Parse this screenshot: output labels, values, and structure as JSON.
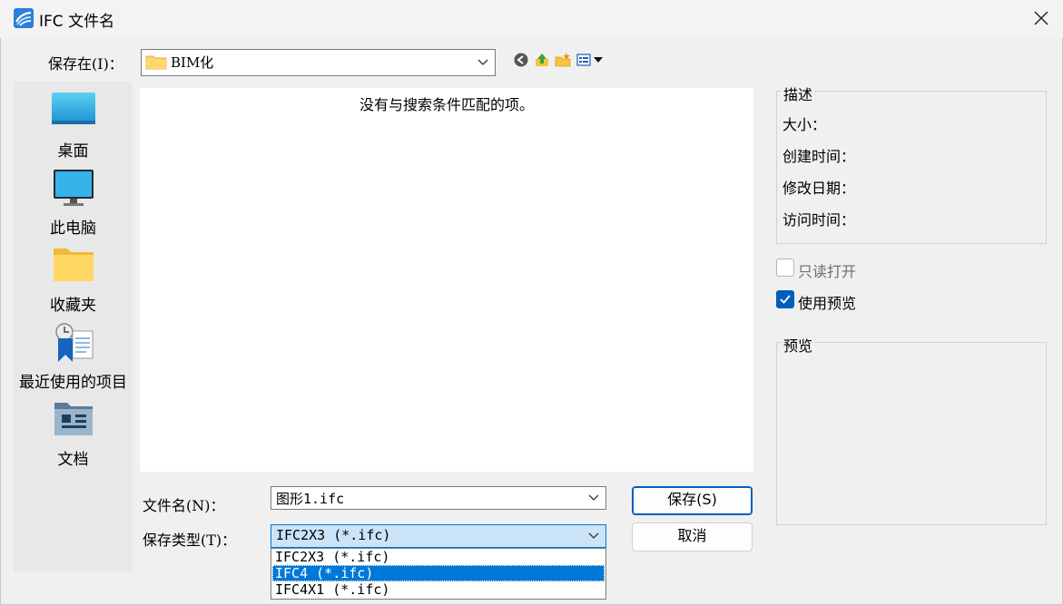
{
  "window": {
    "title": "IFC 文件名"
  },
  "save_in": {
    "label": "保存在(I)：",
    "value": "BIM化"
  },
  "places": [
    {
      "label": "桌面",
      "icon": "desktop-icon"
    },
    {
      "label": "此电脑",
      "icon": "computer-icon"
    },
    {
      "label": "收藏夹",
      "icon": "folder-icon"
    },
    {
      "label": "最近使用的项目",
      "icon": "recent-icon"
    },
    {
      "label": "文档",
      "icon": "documents-icon"
    }
  ],
  "file_list": {
    "empty_text": "没有与搜索条件匹配的项。"
  },
  "description": {
    "title": "描述",
    "rows": [
      "大小：",
      "创建时间：",
      "修改日期：",
      "访问时间："
    ]
  },
  "options": {
    "read_only": {
      "label": "只读打开",
      "checked": false
    },
    "use_preview": {
      "label": "使用预览",
      "checked": true
    }
  },
  "preview": {
    "title": "预览"
  },
  "filename": {
    "label": "文件名(N)：",
    "value": "图形1.ifc"
  },
  "filetype": {
    "label": "保存类型(T)：",
    "value": "IFC2X3 (*.ifc)",
    "options": [
      "IFC2X3 (*.ifc)",
      "IFC4 (*.ifc)",
      "IFC4X1 (*.ifc)"
    ],
    "highlighted": "IFC4 (*.ifc)"
  },
  "buttons": {
    "save": "保存(S)",
    "cancel": "取消"
  },
  "colors": {
    "accent": "#005fb8",
    "selection": "#0078d7",
    "combo_focus": "#cce4f7"
  }
}
